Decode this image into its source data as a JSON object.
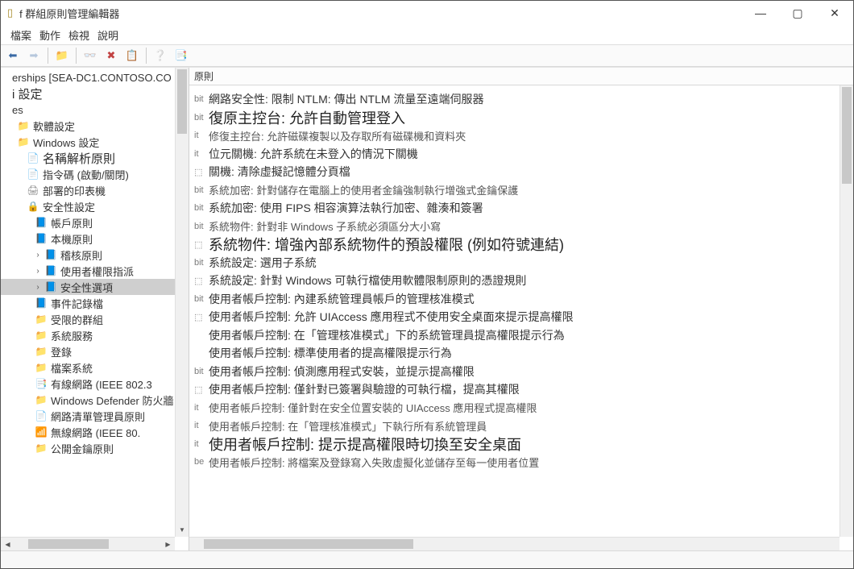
{
  "window": {
    "title": "f 群組原則管理編輯器"
  },
  "menu": [
    "檔案",
    "動作",
    "檢視",
    "說明"
  ],
  "content_header": "原則",
  "tree": [
    {
      "ind": 0,
      "ico": "",
      "txt": "erships [SEA-DC1.CONTOSO.CO",
      "cls": ""
    },
    {
      "ind": 0,
      "ico": "",
      "txt": "i 設定",
      "cls": "bold"
    },
    {
      "ind": 0,
      "ico": "",
      "txt": "es",
      "cls": ""
    },
    {
      "ind": 6,
      "ico": "📁",
      "txt": "軟體設定",
      "cls": ""
    },
    {
      "ind": 6,
      "ico": "📁",
      "txt": "Windows 設定",
      "cls": ""
    },
    {
      "ind": 18,
      "ico": "📄",
      "txt": "名稱解析原則",
      "cls": "bold"
    },
    {
      "ind": 18,
      "ico": "📄",
      "txt": "指令碼 (啟動/關閉)",
      "cls": ""
    },
    {
      "ind": 18,
      "ico": "🖨",
      "txt": "部署的印表機",
      "cls": ""
    },
    {
      "ind": 18,
      "ico": "🔒",
      "txt": "安全性設定",
      "cls": ""
    },
    {
      "ind": 28,
      "ico": "📘",
      "txt": "帳戶原則",
      "cls": ""
    },
    {
      "ind": 28,
      "ico": "📘",
      "txt": "本機原則",
      "cls": ""
    },
    {
      "ind": 40,
      "ico": "📘",
      "txt": "稽核原則",
      "cls": "",
      "exp": "›"
    },
    {
      "ind": 40,
      "ico": "📘",
      "txt": "使用者權限指派",
      "cls": "",
      "exp": "›"
    },
    {
      "ind": 40,
      "ico": "📘",
      "txt": "安全性選項",
      "cls": "sel",
      "exp": "›"
    },
    {
      "ind": 28,
      "ico": "📘",
      "txt": "事件記錄檔",
      "cls": ""
    },
    {
      "ind": 28,
      "ico": "📁",
      "txt": "受限的群組",
      "cls": ""
    },
    {
      "ind": 28,
      "ico": "📁",
      "txt": "系統服務",
      "cls": ""
    },
    {
      "ind": 28,
      "ico": "📁",
      "txt": "登錄",
      "cls": ""
    },
    {
      "ind": 28,
      "ico": "📁",
      "txt": "檔案系統",
      "cls": ""
    },
    {
      "ind": 28,
      "ico": "📑",
      "txt": "有線網路 (IEEE 802.3",
      "cls": ""
    },
    {
      "ind": 28,
      "ico": "📁",
      "txt": "Windows Defender 防火牆",
      "cls": ""
    },
    {
      "ind": 28,
      "ico": "📄",
      "txt": "網路清單管理員原則",
      "cls": ""
    },
    {
      "ind": 28,
      "ico": "📶",
      "txt": "無線網路 (IEEE 80.",
      "cls": ""
    },
    {
      "ind": 28,
      "ico": "📁",
      "txt": "公開金鑰原則",
      "cls": ""
    }
  ],
  "policies": [
    {
      "ico": "bit",
      "txt": "網路安全性: 限制 NTLM: 傳出 NTLM 流量至遠端伺服器",
      "cls": ""
    },
    {
      "ico": "bit",
      "txt": "復原主控台: 允許自動管理登入",
      "cls": "big"
    },
    {
      "ico": "it",
      "txt": "修復主控台: 允許磁碟複製以及存取所有磁碟機和資料夾",
      "cls": "small"
    },
    {
      "ico": "it",
      "txt": "位元關機: 允許系統在未登入的情況下關機",
      "cls": ""
    },
    {
      "ico": "⬚",
      "txt": "關機: 清除虛擬記憶體分頁檔",
      "cls": ""
    },
    {
      "ico": "bit",
      "txt": "系統加密: 針對儲存在電腦上的使用者金鑰強制執行增強式金鑰保護",
      "cls": "small"
    },
    {
      "ico": "bit",
      "txt": "系統加密: 使用 FIPS 相容演算法執行加密、雜湊和簽署",
      "cls": ""
    },
    {
      "ico": "bit",
      "txt": "系統物件: 針對非 Windows 子系統必須區分大小寫",
      "cls": "small"
    },
    {
      "ico": "⬚",
      "txt": "系統物件: 增強內部系統物件的預設權限 (例如符號連結)",
      "cls": "big"
    },
    {
      "ico": "bit",
      "txt": "系統設定: 選用子系統",
      "cls": ""
    },
    {
      "ico": "⬚",
      "txt": "系統設定: 針對 Windows 可執行檔使用軟體限制原則的憑證規則",
      "cls": ""
    },
    {
      "ico": "bit",
      "txt": "使用者帳戶控制: 內建系統管理員帳戶的管理核准模式",
      "cls": ""
    },
    {
      "ico": "⬚",
      "txt": "使用者帳戶控制: 允許 UIAccess 應用程式不使用安全桌面來提示提高權限",
      "cls": ""
    },
    {
      "ico": "",
      "txt": "使用者帳戶控制: 在「管理核准模式」下的系統管理員提高權限提示行為",
      "cls": ""
    },
    {
      "ico": "",
      "txt": "使用者帳戶控制: 標準使用者的提高權限提示行為",
      "cls": ""
    },
    {
      "ico": "bit",
      "txt": "使用者帳戶控制: 偵測應用程式安裝，並提示提高權限",
      "cls": ""
    },
    {
      "ico": "⬚",
      "txt": "使用者帳戶控制: 僅針對已簽署與驗證的可執行檔，提高其權限",
      "cls": ""
    },
    {
      "ico": "it",
      "txt": "使用者帳戶控制: 僅針對在安全位置安裝的 UIAccess 應用程式提高權限",
      "cls": "small"
    },
    {
      "ico": "it",
      "txt": "使用者帳戶控制: 在「管理核准模式」下執行所有系統管理員",
      "cls": "small"
    },
    {
      "ico": "it",
      "txt": "使用者帳戶控制: 提示提高權限時切換至安全桌面",
      "cls": "big"
    },
    {
      "ico": "be",
      "txt": "使用者帳戶控制: 將檔案及登錄寫入失敗虛擬化並儲存至每一使用者位置",
      "cls": "small"
    }
  ]
}
